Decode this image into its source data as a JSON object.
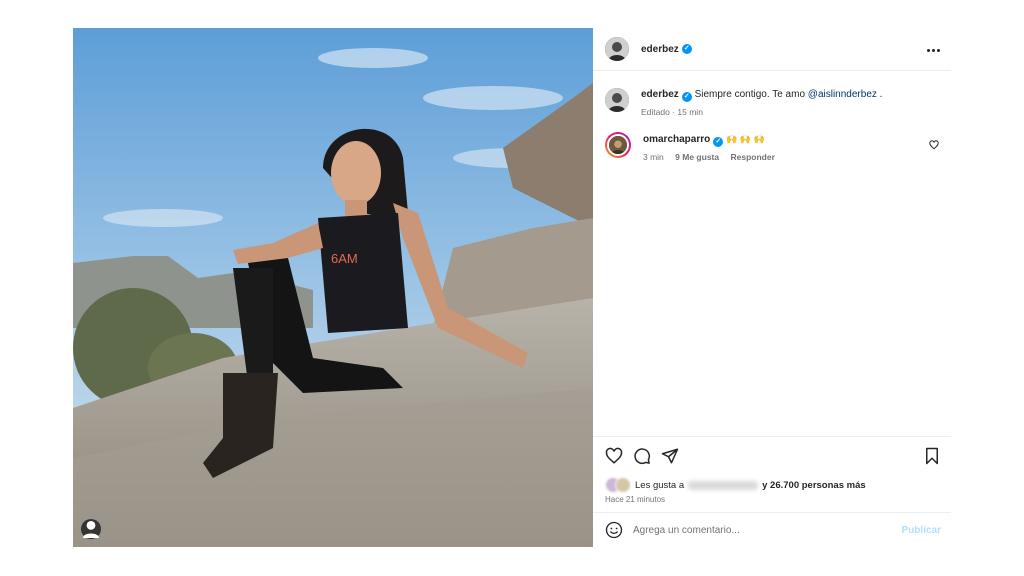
{
  "post": {
    "author": "ederbez",
    "verified": true
  },
  "caption": {
    "author": "ederbez",
    "text": "Siempre contigo. Te amo ",
    "mention": "@aislinnderbez",
    "end": " .",
    "edited": "Editado",
    "age": "15 min"
  },
  "comment": {
    "author": "omarchaparro",
    "text": "🙌 🙌 🙌",
    "age": "3 min",
    "likes": "9 Me gusta",
    "reply": "Responder"
  },
  "likes": {
    "prefix": "Les gusta a",
    "suffix": "y 26.700 personas más"
  },
  "timestamp": "Hace 21 minutos",
  "composer": {
    "placeholder": "Agrega un comentario...",
    "publish": "Publicar"
  },
  "photo": {
    "shirt_text": "6AM"
  },
  "colors": {
    "verified": "#0095f6",
    "publish_disabled": "#b2dffc",
    "mention": "#00376b"
  }
}
